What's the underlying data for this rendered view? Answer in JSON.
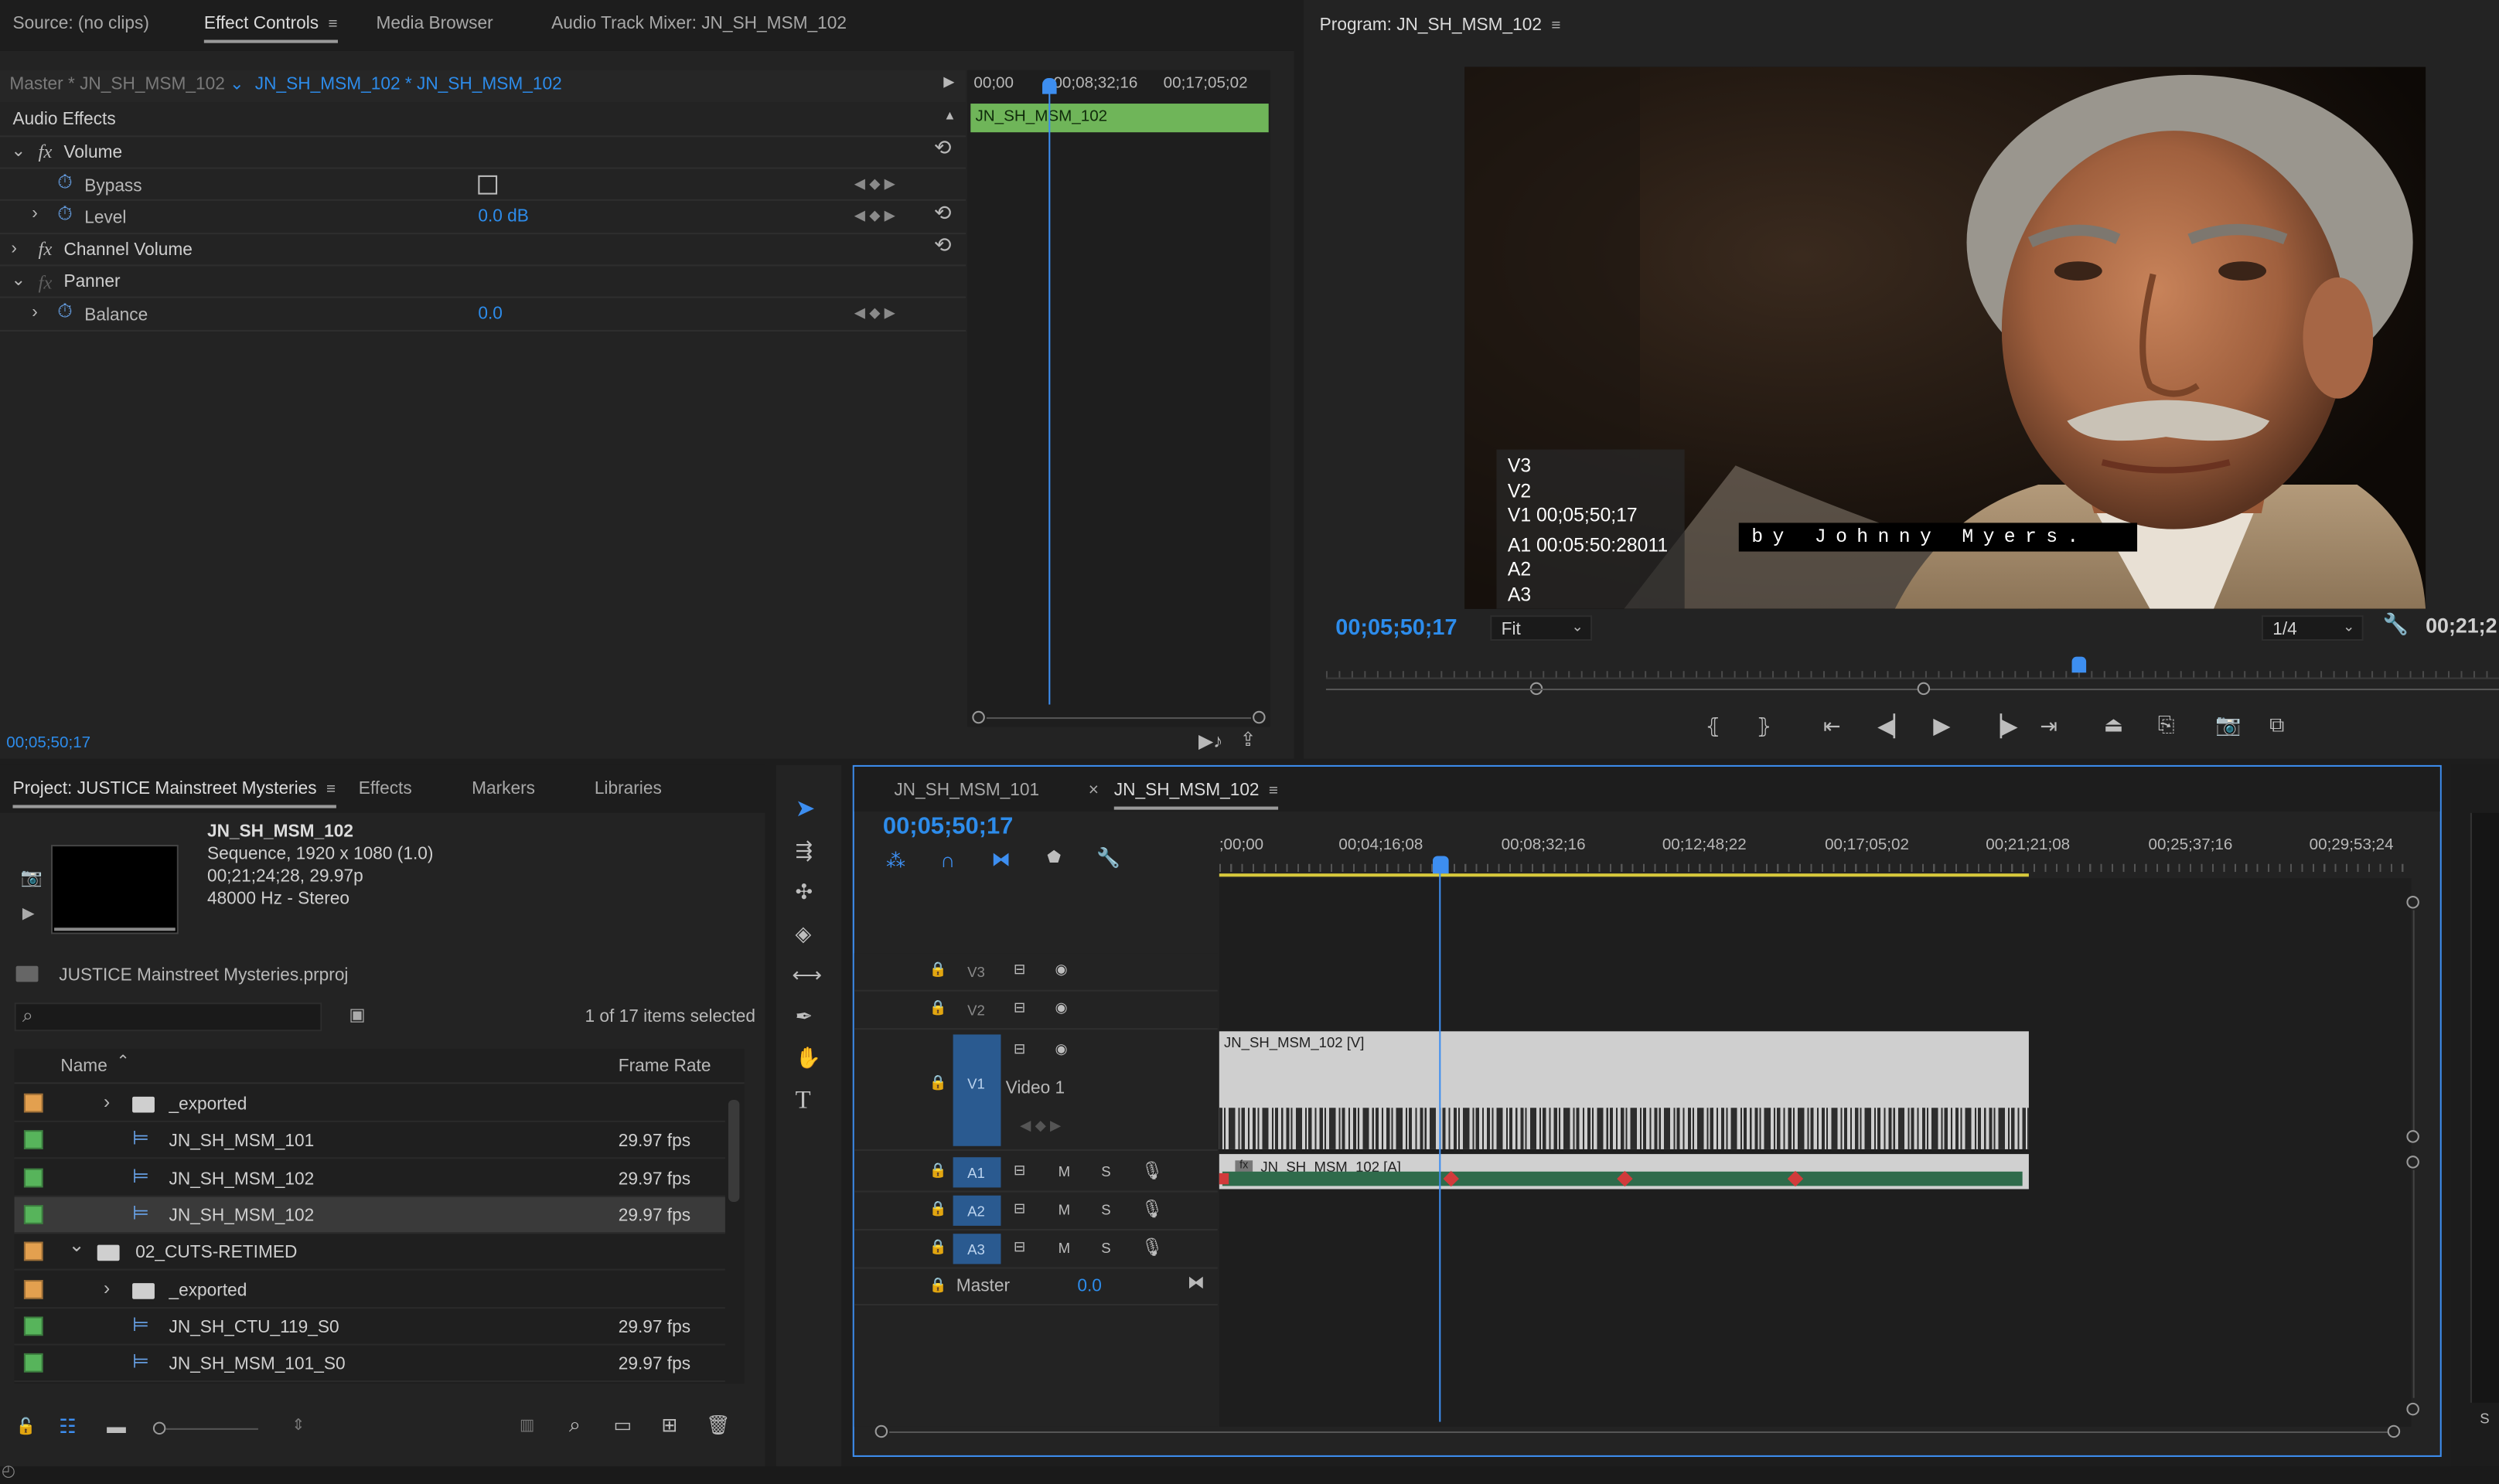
{
  "colors": {
    "accent": "#2d8ceb",
    "clip_green": "#6fb559",
    "audio_clip": "#2f6b4b",
    "marker_red": "#d13b3b",
    "label_orange": "#e3a04f",
    "label_green": "#57b45b"
  },
  "source_panel": {
    "tabs": [
      "Source: (no clips)",
      "Effect Controls",
      "Media Browser",
      "Audio Track Mixer: JN_SH_MSM_102"
    ],
    "master_label": "Master * JN_SH_MSM_102",
    "sequence_label": "JN_SH_MSM_102 * JN_SH_MSM_102",
    "ruler": [
      "00;00",
      "00;08;32;16",
      "00;17;05;02"
    ],
    "clip_name": "JN_SH_MSM_102",
    "section": "Audio Effects",
    "effects": [
      {
        "name": "Volume",
        "indent": 0
      },
      {
        "name": "Bypass",
        "indent": 2
      },
      {
        "name": "Level",
        "indent": 2,
        "value": "0.0 dB"
      },
      {
        "name": "Channel Volume",
        "indent": 0
      },
      {
        "name": "Panner",
        "indent": 0
      },
      {
        "name": "Balance",
        "indent": 2,
        "value": "0.0"
      }
    ],
    "timecode": "00;05;50;17"
  },
  "program_panel": {
    "title": "Program: JN_SH_MSM_102",
    "overlay_lines": [
      "V3",
      "V2",
      "V1 00;05;50;17",
      "A1 00:05:50:28011",
      "A2",
      "A3"
    ],
    "caption": "by Johnny Myers.",
    "timecode": "00;05;50;17",
    "fit": "Fit",
    "resolution": "1/4",
    "duration": "00;21;2"
  },
  "project_panel": {
    "tabs": [
      "Project: JUSTICE Mainstreet Mysteries",
      "Effects",
      "Markers",
      "Libraries"
    ],
    "preview_name": "JN_SH_MSM_102",
    "preview_meta": [
      "Sequence, 1920 x 1080 (1.0)",
      "00;21;24;28, 29.97p",
      "48000 Hz - Stereo"
    ],
    "project_file": "JUSTICE Mainstreet Mysteries.prproj",
    "selection_info": "1 of 17 items selected",
    "columns": [
      "Name",
      "Frame Rate"
    ],
    "items": [
      {
        "type": "bin",
        "name": "_exported",
        "rate": "",
        "color": "orange",
        "level": 1
      },
      {
        "type": "seq",
        "name": "JN_SH_MSM_101",
        "rate": "29.97 fps",
        "color": "green",
        "level": 2
      },
      {
        "type": "seq",
        "name": "JN_SH_MSM_102",
        "rate": "29.97 fps",
        "color": "green",
        "level": 2
      },
      {
        "type": "seq",
        "name": "JN_SH_MSM_102",
        "rate": "29.97 fps",
        "color": "green",
        "level": 2,
        "selected": true
      },
      {
        "type": "bin",
        "name": "02_CUTS-RETIMED",
        "rate": "",
        "color": "orange",
        "level": 0,
        "open": true
      },
      {
        "type": "bin",
        "name": "_exported",
        "rate": "",
        "color": "orange",
        "level": 1
      },
      {
        "type": "seq",
        "name": "JN_SH_CTU_119_S0",
        "rate": "29.97 fps",
        "color": "green",
        "level": 2
      },
      {
        "type": "seq",
        "name": "JN_SH_MSM_101_S0",
        "rate": "29.97 fps",
        "color": "green",
        "level": 2
      }
    ]
  },
  "timeline": {
    "tabs": [
      "JN_SH_MSM_101",
      "JN_SH_MSM_102"
    ],
    "timecode": "00;05;50;17",
    "ruler": [
      ";00;00",
      "00;04;16;08",
      "00;08;32;16",
      "00;12;48;22",
      "00;17;05;02",
      "00;21;21;08",
      "00;25;37;16",
      "00;29;53;24"
    ],
    "video_tracks": [
      "V3",
      "V2",
      "V1"
    ],
    "video1_name": "Video 1",
    "audio_tracks": [
      "A1",
      "A2",
      "A3"
    ],
    "mute": "M",
    "solo": "S",
    "master": "Master",
    "master_value": "0.0",
    "video_clip": "JN_SH_MSM_102 [V]",
    "audio_clip": "JN_SH_MSM_102 [A]"
  },
  "icons": {
    "menu": "≡",
    "play": "▶",
    "lock": "🔒",
    "eye": "◉",
    "mic": "🎤",
    "search": "⌕",
    "wrench": "🔧"
  }
}
